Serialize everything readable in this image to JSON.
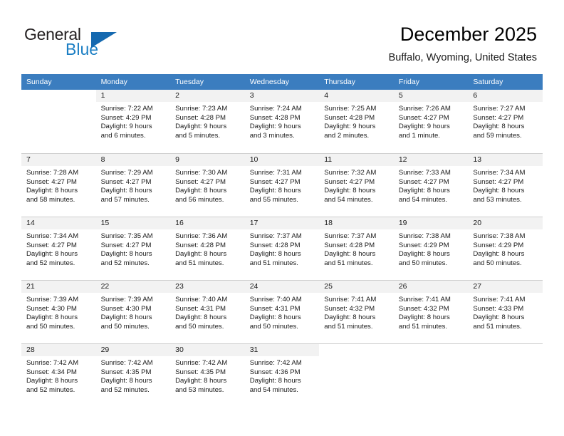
{
  "brand": {
    "line1": "General",
    "line2": "Blue",
    "logo_icon": "triangle-flag-icon",
    "colors": {
      "blue": "#1c7fc4",
      "dark_blue": "#1569b0",
      "text": "#231f20"
    }
  },
  "header": {
    "title": "December 2025",
    "location": "Buffalo, Wyoming, United States"
  },
  "calendar": {
    "header_background": "#3b7dbf",
    "daynum_background": "#f2f2f2",
    "weekday_headers": [
      "Sunday",
      "Monday",
      "Tuesday",
      "Wednesday",
      "Thursday",
      "Friday",
      "Saturday"
    ],
    "weeks": [
      [
        {
          "day": "",
          "lines": []
        },
        {
          "day": "1",
          "lines": [
            "Sunrise: 7:22 AM",
            "Sunset: 4:29 PM",
            "Daylight: 9 hours",
            "and 6 minutes."
          ]
        },
        {
          "day": "2",
          "lines": [
            "Sunrise: 7:23 AM",
            "Sunset: 4:28 PM",
            "Daylight: 9 hours",
            "and 5 minutes."
          ]
        },
        {
          "day": "3",
          "lines": [
            "Sunrise: 7:24 AM",
            "Sunset: 4:28 PM",
            "Daylight: 9 hours",
            "and 3 minutes."
          ]
        },
        {
          "day": "4",
          "lines": [
            "Sunrise: 7:25 AM",
            "Sunset: 4:28 PM",
            "Daylight: 9 hours",
            "and 2 minutes."
          ]
        },
        {
          "day": "5",
          "lines": [
            "Sunrise: 7:26 AM",
            "Sunset: 4:27 PM",
            "Daylight: 9 hours",
            "and 1 minute."
          ]
        },
        {
          "day": "6",
          "lines": [
            "Sunrise: 7:27 AM",
            "Sunset: 4:27 PM",
            "Daylight: 8 hours",
            "and 59 minutes."
          ]
        }
      ],
      [
        {
          "day": "7",
          "lines": [
            "Sunrise: 7:28 AM",
            "Sunset: 4:27 PM",
            "Daylight: 8 hours",
            "and 58 minutes."
          ]
        },
        {
          "day": "8",
          "lines": [
            "Sunrise: 7:29 AM",
            "Sunset: 4:27 PM",
            "Daylight: 8 hours",
            "and 57 minutes."
          ]
        },
        {
          "day": "9",
          "lines": [
            "Sunrise: 7:30 AM",
            "Sunset: 4:27 PM",
            "Daylight: 8 hours",
            "and 56 minutes."
          ]
        },
        {
          "day": "10",
          "lines": [
            "Sunrise: 7:31 AM",
            "Sunset: 4:27 PM",
            "Daylight: 8 hours",
            "and 55 minutes."
          ]
        },
        {
          "day": "11",
          "lines": [
            "Sunrise: 7:32 AM",
            "Sunset: 4:27 PM",
            "Daylight: 8 hours",
            "and 54 minutes."
          ]
        },
        {
          "day": "12",
          "lines": [
            "Sunrise: 7:33 AM",
            "Sunset: 4:27 PM",
            "Daylight: 8 hours",
            "and 54 minutes."
          ]
        },
        {
          "day": "13",
          "lines": [
            "Sunrise: 7:34 AM",
            "Sunset: 4:27 PM",
            "Daylight: 8 hours",
            "and 53 minutes."
          ]
        }
      ],
      [
        {
          "day": "14",
          "lines": [
            "Sunrise: 7:34 AM",
            "Sunset: 4:27 PM",
            "Daylight: 8 hours",
            "and 52 minutes."
          ]
        },
        {
          "day": "15",
          "lines": [
            "Sunrise: 7:35 AM",
            "Sunset: 4:27 PM",
            "Daylight: 8 hours",
            "and 52 minutes."
          ]
        },
        {
          "day": "16",
          "lines": [
            "Sunrise: 7:36 AM",
            "Sunset: 4:28 PM",
            "Daylight: 8 hours",
            "and 51 minutes."
          ]
        },
        {
          "day": "17",
          "lines": [
            "Sunrise: 7:37 AM",
            "Sunset: 4:28 PM",
            "Daylight: 8 hours",
            "and 51 minutes."
          ]
        },
        {
          "day": "18",
          "lines": [
            "Sunrise: 7:37 AM",
            "Sunset: 4:28 PM",
            "Daylight: 8 hours",
            "and 51 minutes."
          ]
        },
        {
          "day": "19",
          "lines": [
            "Sunrise: 7:38 AM",
            "Sunset: 4:29 PM",
            "Daylight: 8 hours",
            "and 50 minutes."
          ]
        },
        {
          "day": "20",
          "lines": [
            "Sunrise: 7:38 AM",
            "Sunset: 4:29 PM",
            "Daylight: 8 hours",
            "and 50 minutes."
          ]
        }
      ],
      [
        {
          "day": "21",
          "lines": [
            "Sunrise: 7:39 AM",
            "Sunset: 4:30 PM",
            "Daylight: 8 hours",
            "and 50 minutes."
          ]
        },
        {
          "day": "22",
          "lines": [
            "Sunrise: 7:39 AM",
            "Sunset: 4:30 PM",
            "Daylight: 8 hours",
            "and 50 minutes."
          ]
        },
        {
          "day": "23",
          "lines": [
            "Sunrise: 7:40 AM",
            "Sunset: 4:31 PM",
            "Daylight: 8 hours",
            "and 50 minutes."
          ]
        },
        {
          "day": "24",
          "lines": [
            "Sunrise: 7:40 AM",
            "Sunset: 4:31 PM",
            "Daylight: 8 hours",
            "and 50 minutes."
          ]
        },
        {
          "day": "25",
          "lines": [
            "Sunrise: 7:41 AM",
            "Sunset: 4:32 PM",
            "Daylight: 8 hours",
            "and 51 minutes."
          ]
        },
        {
          "day": "26",
          "lines": [
            "Sunrise: 7:41 AM",
            "Sunset: 4:32 PM",
            "Daylight: 8 hours",
            "and 51 minutes."
          ]
        },
        {
          "day": "27",
          "lines": [
            "Sunrise: 7:41 AM",
            "Sunset: 4:33 PM",
            "Daylight: 8 hours",
            "and 51 minutes."
          ]
        }
      ],
      [
        {
          "day": "28",
          "lines": [
            "Sunrise: 7:42 AM",
            "Sunset: 4:34 PM",
            "Daylight: 8 hours",
            "and 52 minutes."
          ]
        },
        {
          "day": "29",
          "lines": [
            "Sunrise: 7:42 AM",
            "Sunset: 4:35 PM",
            "Daylight: 8 hours",
            "and 52 minutes."
          ]
        },
        {
          "day": "30",
          "lines": [
            "Sunrise: 7:42 AM",
            "Sunset: 4:35 PM",
            "Daylight: 8 hours",
            "and 53 minutes."
          ]
        },
        {
          "day": "31",
          "lines": [
            "Sunrise: 7:42 AM",
            "Sunset: 4:36 PM",
            "Daylight: 8 hours",
            "and 54 minutes."
          ]
        },
        {
          "day": "",
          "lines": []
        },
        {
          "day": "",
          "lines": []
        },
        {
          "day": "",
          "lines": []
        }
      ]
    ]
  }
}
